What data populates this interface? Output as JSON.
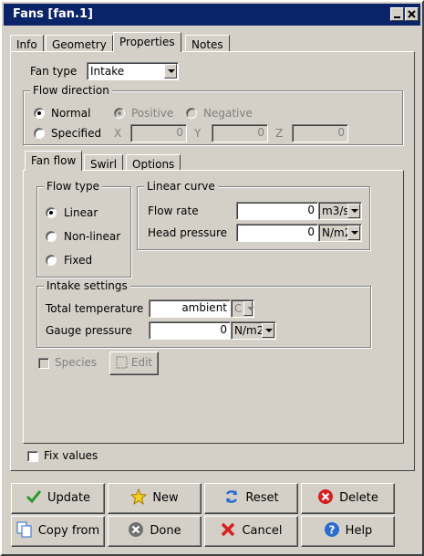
{
  "window": {
    "title": "Fans [fan.1]"
  },
  "tabs": [
    "Info",
    "Geometry",
    "Properties",
    "Notes"
  ],
  "fan_type": {
    "label": "Fan type",
    "value": "Intake"
  },
  "flow_direction": {
    "title": "Flow direction",
    "normal": "Normal",
    "positive": "Positive",
    "negative": "Negative",
    "specified": "Specified",
    "x_label": "X",
    "x_value": "0",
    "y_label": "Y",
    "y_value": "0",
    "z_label": "Z",
    "z_value": "0"
  },
  "subtabs": [
    "Fan flow",
    "Swirl",
    "Options"
  ],
  "flow_type": {
    "title": "Flow type",
    "linear": "Linear",
    "nonlinear": "Non-linear",
    "fixed": "Fixed"
  },
  "linear_curve": {
    "title": "Linear curve",
    "flow_rate_label": "Flow rate",
    "flow_rate_value": "0",
    "flow_rate_unit": "m3/s",
    "head_pressure_label": "Head pressure",
    "head_pressure_value": "0",
    "head_pressure_unit": "N/m2"
  },
  "intake": {
    "title": "Intake settings",
    "total_temp_label": "Total temperature",
    "total_temp_value": "ambient",
    "total_temp_unit": "C",
    "gauge_label": "Gauge pressure",
    "gauge_value": "0",
    "gauge_unit": "N/m2"
  },
  "species": {
    "label": "Species",
    "edit": "Edit"
  },
  "fix_values": "Fix values",
  "buttons": {
    "update": "Update",
    "new": "New",
    "reset": "Reset",
    "delete": "Delete",
    "copy_from": "Copy from",
    "done": "Done",
    "cancel": "Cancel",
    "help": "Help"
  },
  "colors": {
    "titlebar": "#0a246a",
    "face": "#d4d0c8"
  }
}
